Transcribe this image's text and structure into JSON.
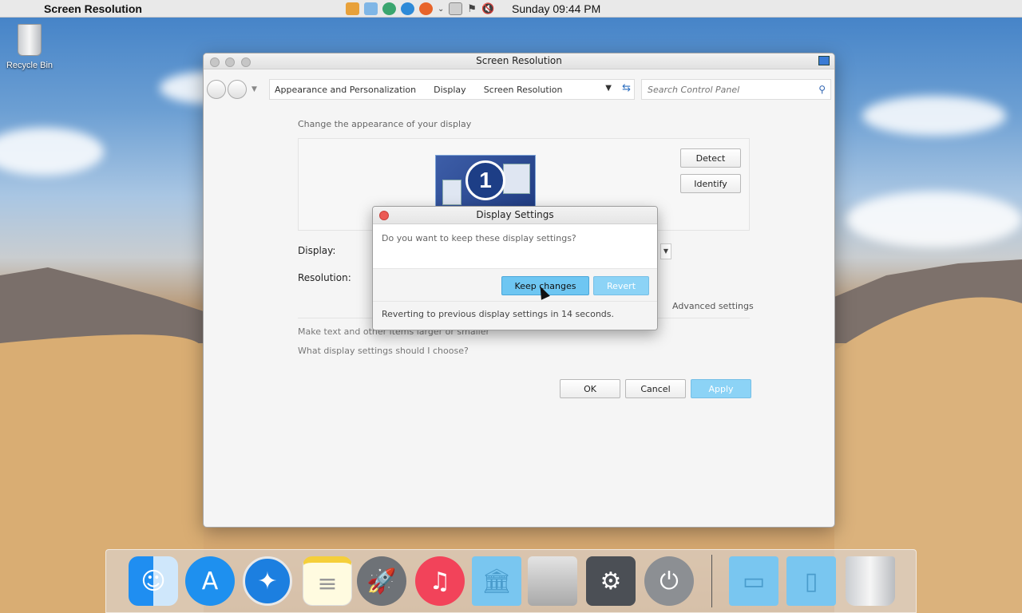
{
  "menubar": {
    "app_title": "Screen Resolution",
    "clock": "Sunday 09:44 PM",
    "tray_icons": [
      "media-player-icon",
      "network-icon",
      "chat-icon",
      "edge-icon",
      "firefox-icon",
      "chevron-down-icon",
      "clipboard-icon",
      "flag-icon",
      "volume-icon"
    ]
  },
  "desktop": {
    "recycle_bin_label": "Recycle Bin"
  },
  "window": {
    "title": "Screen Resolution",
    "breadcrumb": [
      "Appearance and Personalization",
      "Display",
      "Screen Resolution"
    ],
    "search_placeholder": "Search Control Panel",
    "heading": "Change the appearance of your display",
    "monitor_number": "1",
    "detect_label": "Detect",
    "identify_label": "Identify",
    "display_label": "Display:",
    "resolution_label": "Resolution:",
    "advanced_link": "Advanced settings",
    "help_link_1": "Make text and other items larger or smaller",
    "help_link_2": "What display settings should I choose?",
    "ok_label": "OK",
    "cancel_label": "Cancel",
    "apply_label": "Apply"
  },
  "dialog": {
    "title": "Display Settings",
    "question": "Do you want to keep these display settings?",
    "keep_label": "Keep changes",
    "revert_label": "Revert",
    "status": "Reverting to previous display settings in 14 seconds."
  },
  "dock": {
    "items": [
      "finder-icon",
      "app-store-icon",
      "safari-icon",
      "notes-icon",
      "launchpad-icon",
      "music-icon",
      "applications-folder-icon",
      "mac-pro-icon",
      "system-preferences-icon",
      "power-icon",
      "folder-icon",
      "documents-folder-icon",
      "trash-icon"
    ]
  },
  "colors": {
    "accent": "#6ec6f2",
    "close_red": "#ec5a54"
  }
}
